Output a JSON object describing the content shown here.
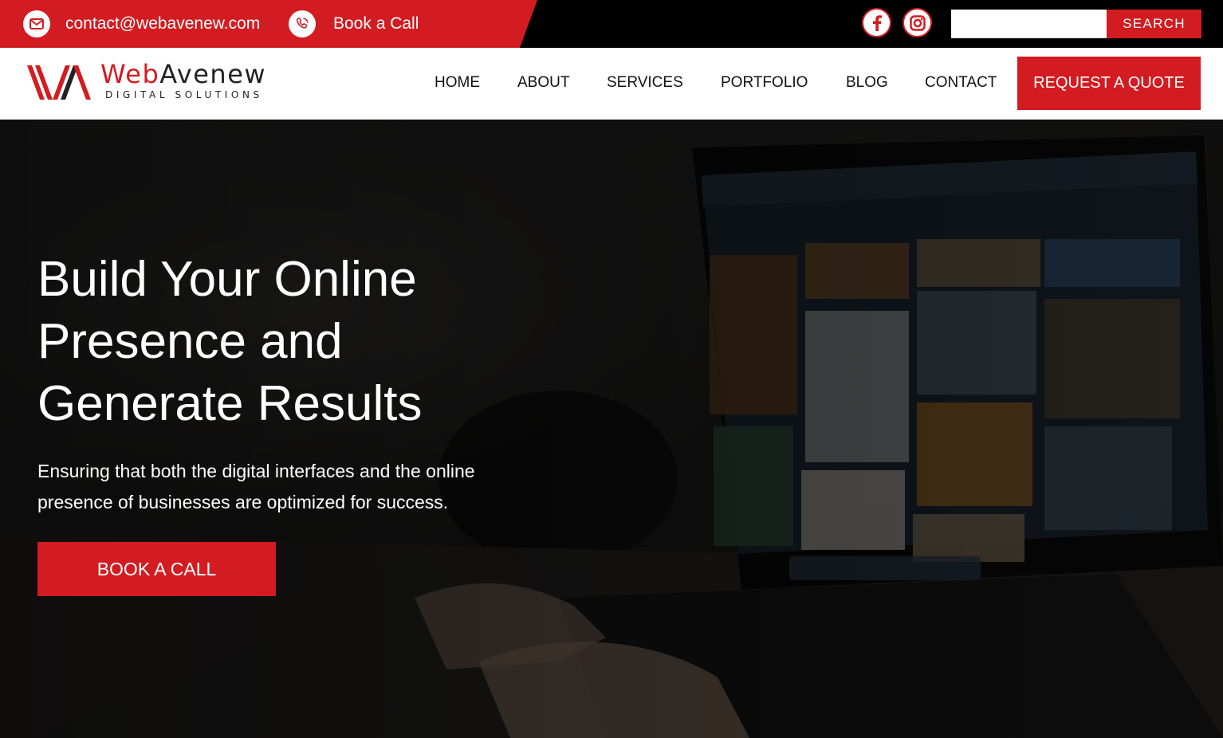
{
  "topbar": {
    "email": "contact@webavenew.com",
    "book_call": "Book a Call",
    "email_icon": "envelope-icon",
    "phone_icon": "phone-icon",
    "social": [
      "facebook-icon",
      "instagram-icon"
    ],
    "search_placeholder": "",
    "search_label": "SEARCH"
  },
  "logo": {
    "name_part1": "Web",
    "name_part2": "Avenew",
    "tagline": "DIGITAL SOLUTIONS"
  },
  "nav": {
    "items": [
      "HOME",
      "ABOUT",
      "SERVICES",
      "PORTFOLIO",
      "BLOG",
      "CONTACT"
    ],
    "cta": "REQUEST A QUOTE"
  },
  "hero": {
    "title_line1": "Build Your Online",
    "title_line2": "Presence and",
    "title_line3": "Generate Results",
    "subtitle_line1": "Ensuring that both the digital interfaces and the online",
    "subtitle_line2": "presence of businesses are optimized for success.",
    "button": "BOOK A CALL"
  },
  "colors": {
    "brand_red": "#d21c21",
    "topbar_black": "#000000",
    "header_white": "#ffffff"
  }
}
